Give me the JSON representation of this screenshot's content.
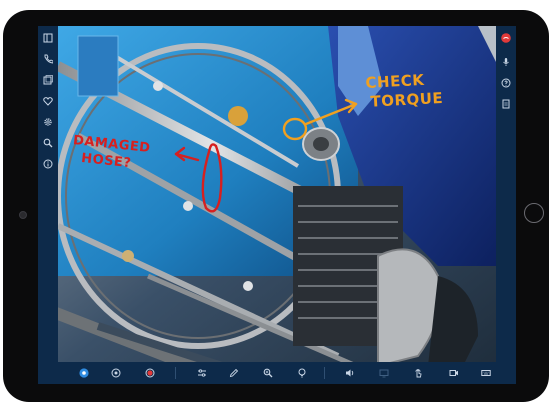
{
  "annotations": {
    "check_line1": "CHECK",
    "check_line2": "TORQUE",
    "damaged_line1": "DAMAGED",
    "damaged_line2": "HOSE?"
  },
  "colors": {
    "toolbar_bg": "#0d2a4a",
    "icon_color": "#c9d6e6",
    "active_blue": "#2f8be0",
    "record_red": "#e23a3a",
    "annot_orange": "#f0a020",
    "annot_red": "#d62020"
  },
  "left_toolbar": {
    "icons": [
      "sidebar-toggle-icon",
      "phone-icon",
      "gallery-icon",
      "heart-icon",
      "settings-gear-icon",
      "search-icon",
      "info-icon"
    ]
  },
  "right_toolbar": {
    "icons": [
      "end-call-icon",
      "microphone-icon",
      "help-icon",
      "document-icon"
    ]
  },
  "bottom_toolbar": {
    "icons": [
      "live-view-icon",
      "snapshot-icon",
      "record-icon",
      "adjust-sliders-icon",
      "pen-draw-icon",
      "zoom-icon",
      "flashlight-icon",
      "volume-icon",
      "share-screen-icon",
      "touch-pointer-icon",
      "video-camera-icon",
      "keyboard-icon"
    ]
  }
}
